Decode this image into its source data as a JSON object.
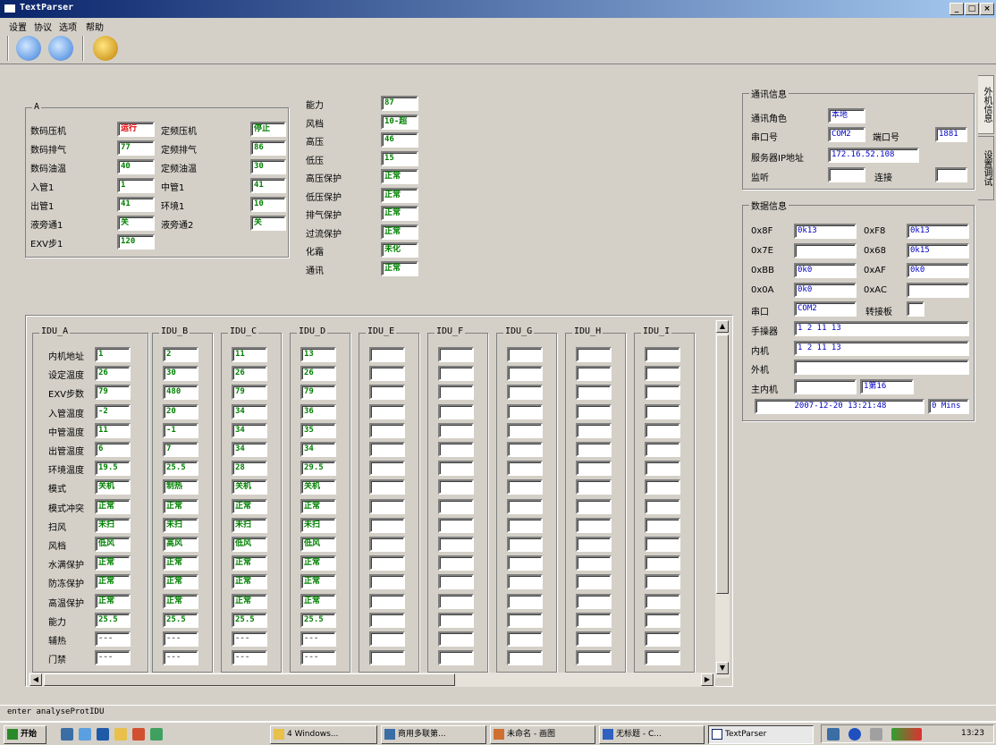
{
  "window": {
    "title": "TextParser",
    "min": "_",
    "max": "□",
    "close": "×"
  },
  "menu": [
    "设置",
    "协议",
    "选项",
    "帮助"
  ],
  "outdoor": {
    "group_title": "A",
    "col1_labels": [
      "数码压机",
      "数码排气",
      "数码油温",
      "入管1",
      "出管1",
      "液旁通1",
      "EXV步1"
    ],
    "col1_values": [
      "运行",
      "77",
      "40",
      "1",
      "41",
      "关",
      "120"
    ],
    "col2_labels": [
      "定频压机",
      "定频排气",
      "定频油温",
      "中管1",
      "环境1",
      "液旁通2"
    ],
    "col2_values": [
      "停止",
      "86",
      "30",
      "41",
      "10",
      "关"
    ],
    "col3_labels": [
      "能力",
      "风档",
      "高压",
      "低压",
      "高压保护",
      "低压保护",
      "排气保护",
      "过流保护",
      "化霜",
      "通讯"
    ],
    "col3_values": [
      "87",
      "10-超",
      "46",
      "15",
      "正常",
      "正常",
      "正常",
      "正常",
      "未化",
      "正常"
    ]
  },
  "comm": {
    "title": "通讯信息",
    "role_label": "通讯角色",
    "role_value": "本地",
    "port_label": "串口号",
    "port_value": "COM2",
    "netport_label": "端口号",
    "netport_value": "1881",
    "server_label": "服务器IP地址",
    "server_value": "172.16.52.108",
    "listen_label": "监听",
    "connect_label": "连接"
  },
  "datainfo": {
    "title": "数据信息",
    "rows": [
      {
        "l1": "0x8F",
        "v1": "0k13",
        "l2": "0xF8",
        "v2": "0k13"
      },
      {
        "l1": "0x7E",
        "v1": "",
        "l2": "0x68",
        "v2": "0k15"
      },
      {
        "l1": "0xBB",
        "v1": "0k0",
        "l2": "0xAF",
        "v2": "0k0"
      },
      {
        "l1": "0x0A",
        "v1": "0k0",
        "l2": "0xAC",
        "v2": ""
      }
    ],
    "serial_label": "串口",
    "serial_value": "COM2",
    "convert_label": "转接板",
    "wire_label": "手操器",
    "wire_value": "1 2 11 13",
    "inner_label": "内机",
    "inner_value": "1 2 11 13",
    "outer_label": "外机",
    "outer_value": "",
    "master_label": "主内机",
    "master_value": "1第16",
    "time_value": "2007-12-20 13:21:48",
    "mins_value": "0 Mins"
  },
  "tabs": [
    "外机信息",
    "设置调试"
  ],
  "idu": {
    "row_labels": [
      "内机地址",
      "设定温度",
      "EXV步数",
      "入管温度",
      "中管温度",
      "出管温度",
      "环境温度",
      "模式",
      "模式冲突",
      "扫风",
      "风档",
      "水满保护",
      "防冻保护",
      "高温保护",
      "能力",
      "辅热",
      "门禁"
    ],
    "units": [
      {
        "name": "IDU_A",
        "values": [
          "1",
          "26",
          "79",
          "-2",
          "11",
          "6",
          "19.5",
          "关机",
          "正常",
          "未扫",
          "低风",
          "正常",
          "正常",
          "正常",
          "25.5",
          "---",
          "---"
        ]
      },
      {
        "name": "IDU_B",
        "values": [
          "2",
          "30",
          "480",
          "20",
          "-1",
          "7",
          "25.5",
          "制热",
          "正常",
          "未扫",
          "高风",
          "正常",
          "正常",
          "正常",
          "25.5",
          "---",
          "---"
        ]
      },
      {
        "name": "IDU_C",
        "values": [
          "11",
          "26",
          "79",
          "34",
          "34",
          "34",
          "28",
          "关机",
          "正常",
          "未扫",
          "低风",
          "正常",
          "正常",
          "正常",
          "25.5",
          "---",
          "---"
        ]
      },
      {
        "name": "IDU_D",
        "values": [
          "13",
          "26",
          "79",
          "36",
          "35",
          "34",
          "29.5",
          "关机",
          "正常",
          "未扫",
          "低风",
          "正常",
          "正常",
          "正常",
          "25.5",
          "---",
          "---"
        ]
      },
      {
        "name": "IDU_E",
        "values": []
      },
      {
        "name": "IDU_F",
        "values": []
      },
      {
        "name": "IDU_G",
        "values": []
      },
      {
        "name": "IDU_H",
        "values": []
      },
      {
        "name": "IDU_I",
        "values": []
      }
    ]
  },
  "status_text": "enter analyseProtIDU",
  "taskbar": {
    "start": "开始",
    "buttons": [
      "4 Windows...",
      "商用多联第...",
      "未命名 - 画图",
      "无标题 - C...",
      "TextParser"
    ],
    "clock": "13:23"
  },
  "colors": {
    "window_bg": "#d4d0c8",
    "value_green": "#008000",
    "value_red": "#e00000",
    "value_blue": "#0000c0",
    "title_start": "#0a246a"
  }
}
